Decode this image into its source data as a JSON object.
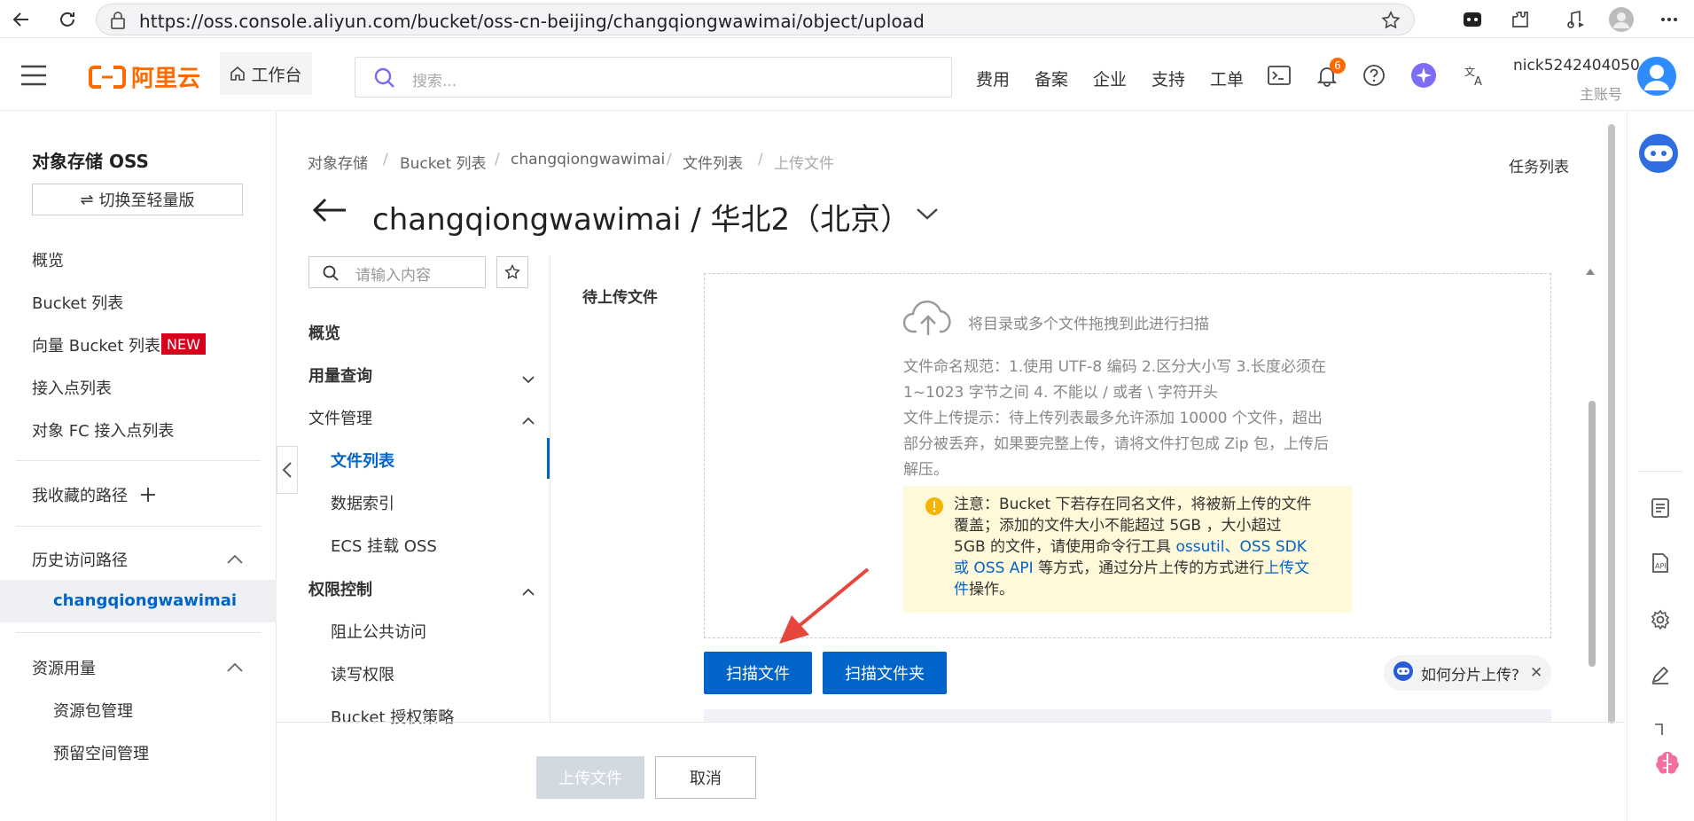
{
  "browser": {
    "url": "https://oss.console.aliyun.com/bucket/oss-cn-beijing/changqiongwawimai/object/upload"
  },
  "topnav": {
    "logo_text": "阿里云",
    "workbench": "工作台",
    "search_placeholder": "搜索...",
    "links": [
      "费用",
      "备案",
      "企业",
      "支持",
      "工单"
    ],
    "notification_count": "6",
    "username": "nick5242404050",
    "account_type": "主账号"
  },
  "sidebar": {
    "title": "对象存储 OSS",
    "switch_button": "切换至轻量版",
    "items": [
      "概览",
      "Bucket 列表",
      "向量 Bucket 列表",
      "接入点列表",
      "对象 FC 接入点列表"
    ],
    "new_badge": "NEW",
    "favorites": "我收藏的路径",
    "history": "历史访问路径",
    "history_item": "changqiongwawimai",
    "resource": "资源用量",
    "resource_items": [
      "资源包管理",
      "预留空间管理"
    ]
  },
  "breadcrumb": [
    "对象存储",
    "Bucket 列表",
    "changqiongwawimai",
    "文件列表",
    "上传文件"
  ],
  "task_list": "任务列表",
  "page_title": "changqiongwawimai / 华北2（北京）",
  "subnav": {
    "search_placeholder": "请输入内容",
    "overview": "概览",
    "usage": "用量查询",
    "file_mgmt": "文件管理",
    "file_list": "文件列表",
    "data_index": "数据索引",
    "ecs_mount": "ECS 挂载 OSS",
    "permission": "权限控制",
    "block_public": "阻止公共访问",
    "rw_perm": "读写权限",
    "bucket_policy": "Bucket 授权策略"
  },
  "upload": {
    "label": "待上传文件",
    "drop_hint": "将目录或多个文件拖拽到此进行扫描",
    "rule1": "文件命名规范：1.使用 UTF-8 编码 2.区分大小写 3.长度必须在",
    "rule2": "1~1023 字节之间 4. 不能以 / 或者 \\ 字符开头",
    "tip1": "文件上传提示：待上传列表最多允许添加 10000 个文件，超出",
    "tip2": "部分被丢弃，如果要完整上传，请将文件打包成 Zip 包，上传后",
    "tip3": "解压。",
    "warn1": "注意：Bucket 下若存在同名文件，将被新上传的文件",
    "warn2": "覆盖；添加的文件大小不能超过 5GB ，大小超过",
    "warn3a": "5GB 的文件，请使用命令行工具 ",
    "warn3_link1": "ossutil",
    "warn3_sep": "、",
    "warn3_link2": "OSS SDK",
    "warn4_link": "或 OSS API",
    "warn4b": " 等方式，通过分片上传的方式进行",
    "warn4_link2": "上传文",
    "warn5_link": "件",
    "warn5b": "操作。",
    "scan_files": "扫描文件",
    "scan_folder": "扫描文件夹",
    "help_text": "如何分片上传?"
  },
  "footer": {
    "upload_button": "上传文件",
    "cancel_button": "取消"
  },
  "colors": {
    "brand": "#ff6a00",
    "primary": "#0064c8",
    "warning_bg": "#fff8d9",
    "arrow": "#e8453c"
  }
}
